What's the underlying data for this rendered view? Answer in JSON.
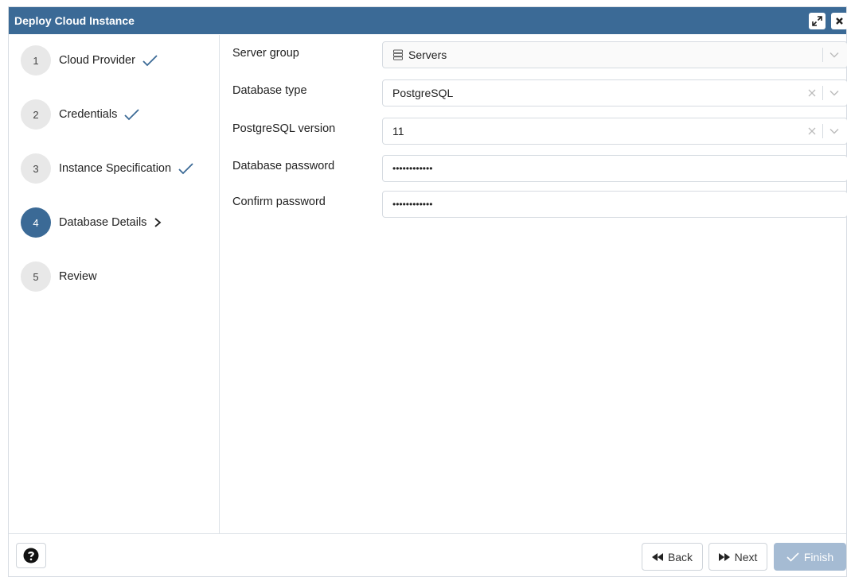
{
  "window": {
    "title": "Deploy Cloud Instance"
  },
  "steps": [
    {
      "number": "1",
      "label": "Cloud Provider",
      "status": "done"
    },
    {
      "number": "2",
      "label": "Credentials",
      "status": "done"
    },
    {
      "number": "3",
      "label": "Instance Specification",
      "status": "done"
    },
    {
      "number": "4",
      "label": "Database Details",
      "status": "current"
    },
    {
      "number": "5",
      "label": "Review",
      "status": "pending"
    }
  ],
  "form": {
    "server_group": {
      "label": "Server group",
      "value": "Servers",
      "icon": "server-group-icon"
    },
    "database_type": {
      "label": "Database type",
      "value": "PostgreSQL"
    },
    "postgresql_version": {
      "label": "PostgreSQL version",
      "value": "11"
    },
    "database_password": {
      "label": "Database password",
      "value": "••••••••••••"
    },
    "confirm_password": {
      "label": "Confirm password",
      "value": "••••••••••••"
    }
  },
  "footer": {
    "back_label": "Back",
    "next_label": "Next",
    "finish_label": "Finish"
  },
  "colors": {
    "accent": "#3b6a96",
    "finish_disabled": "#a5bbd3"
  }
}
